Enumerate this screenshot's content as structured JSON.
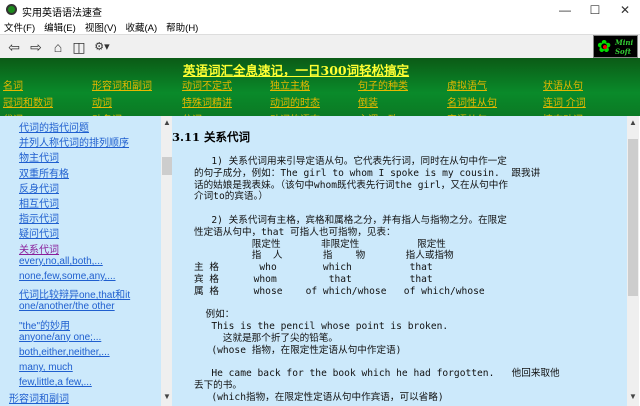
{
  "window": {
    "title": "实用英语语法速查",
    "minimize": "—",
    "maximize": "☐",
    "close": "✕"
  },
  "menu": [
    "文件(F)",
    "编辑(E)",
    "视图(V)",
    "收藏(A)",
    "帮助(H)"
  ],
  "toolbar": {
    "back": "⇦",
    "forward": "⇨",
    "home": "⌂",
    "find": "◫",
    "options": "⚙▾"
  },
  "logo": {
    "line1": "Mini",
    "line2": "Soft"
  },
  "banner": {
    "headline": "英语词汇全息速记，一日300词轻松搞定",
    "rows": [
      [
        "名词",
        "形容词和副词",
        "动词不定式",
        "独立主格",
        "句子的种类",
        "虚拟语气",
        "状语从句"
      ],
      [
        "冠词和数词",
        "动词",
        "特殊词精讲",
        "动词的时态",
        "倒装",
        "名词性从句",
        "连词 介词"
      ],
      [
        "代词",
        "动名词",
        "分词",
        "动词的语态",
        "主谓一致",
        "定语从句",
        "情态动词"
      ]
    ]
  },
  "sidebar": {
    "items": [
      "代词的指代问题",
      "并列人称代词的排列顺序",
      "物主代词",
      "双重所有格",
      "反身代词",
      "相互代词",
      "指示代词",
      "疑问代词",
      "关系代词",
      "every,no,all,both,...",
      "none,few,some,any,...",
      "代词比较辩异one,that和it",
      "one/another/the other",
      "\"the\"的妙用",
      "anyone/any one;...",
      "both,either,neither,...",
      "many, much",
      "few,little,a few,..."
    ],
    "active_index": 8,
    "next_section": "形容词和副词"
  },
  "content": {
    "heading": "3.11 关系代词",
    "lines": [
      "   1) 关系代词用来引导定语从句。它代表先行词，同时在从句中作一定",
      "的句子成分，例如：The girl to whom I spoke is my cousin.  跟我讲",
      "话的姑娘是我表妹。（该句中whom既代表先行词the girl，又在从句中作",
      "介词to的宾语。）",
      "",
      "   2) 关系代词有主格，宾格和属格之分，并有指人与指物之分。在限定",
      "性定语从句中，that 可指人也可指物，见表：",
      "          限定性       非限定性          限定性",
      "          指  人       指    物       指人或指物",
      "主 格       who        which          that",
      "宾 格      whom         that          that",
      "属 格      whose    of which/whose   of which/whose",
      "",
      "  例如：",
      "   This is the pencil whose point is broken.",
      "     这就是那个折了尖的铅笔。",
      "   (whose 指物，在限定性定语从句中作定语)",
      "",
      "   He came back for the book which he had forgotten.   他回来取他",
      "丢下的书。",
      "   (which指物，在限定性定语从句中作宾语，可以省略)"
    ]
  },
  "colors": {
    "banner": "#0a8a2a",
    "link": "#1f5fcf",
    "visited": "#8a1f9b",
    "pane": "#cce9fb",
    "navlink": "#e6b800",
    "headline": "#ffff33"
  }
}
